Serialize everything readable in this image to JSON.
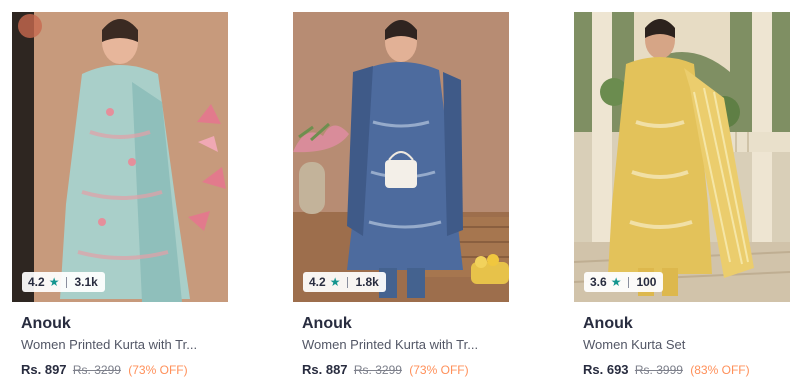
{
  "products": [
    {
      "rating": "4.2",
      "rating_count": "3.1k",
      "brand": "Anouk",
      "title": "Women Printed Kurta with Tr...",
      "price": "Rs. 897",
      "mrp": "Rs. 3299",
      "discount": "(73% OFF)",
      "star_icon": "star-icon",
      "colors": {
        "background": "#c79a7c",
        "outfit": "#a9cfc9",
        "accent": "#e27a8c"
      }
    },
    {
      "rating": "4.2",
      "rating_count": "1.8k",
      "brand": "Anouk",
      "title": "Women Printed Kurta with Tr...",
      "price": "Rs. 887",
      "mrp": "Rs. 3299",
      "discount": "(73% OFF)",
      "star_icon": "star-icon",
      "colors": {
        "background": "#b78c73",
        "outfit": "#4d6b9e",
        "accent": "#d9a54a"
      }
    },
    {
      "rating": "3.6",
      "rating_count": "100",
      "brand": "Anouk",
      "title": "Women Kurta Set",
      "price": "Rs. 693",
      "mrp": "Rs. 3999",
      "discount": "(83% OFF)",
      "star_icon": "star-icon",
      "colors": {
        "background": "#d9cfb8",
        "outfit": "#e3c25a",
        "accent": "#5f7f45"
      }
    }
  ]
}
